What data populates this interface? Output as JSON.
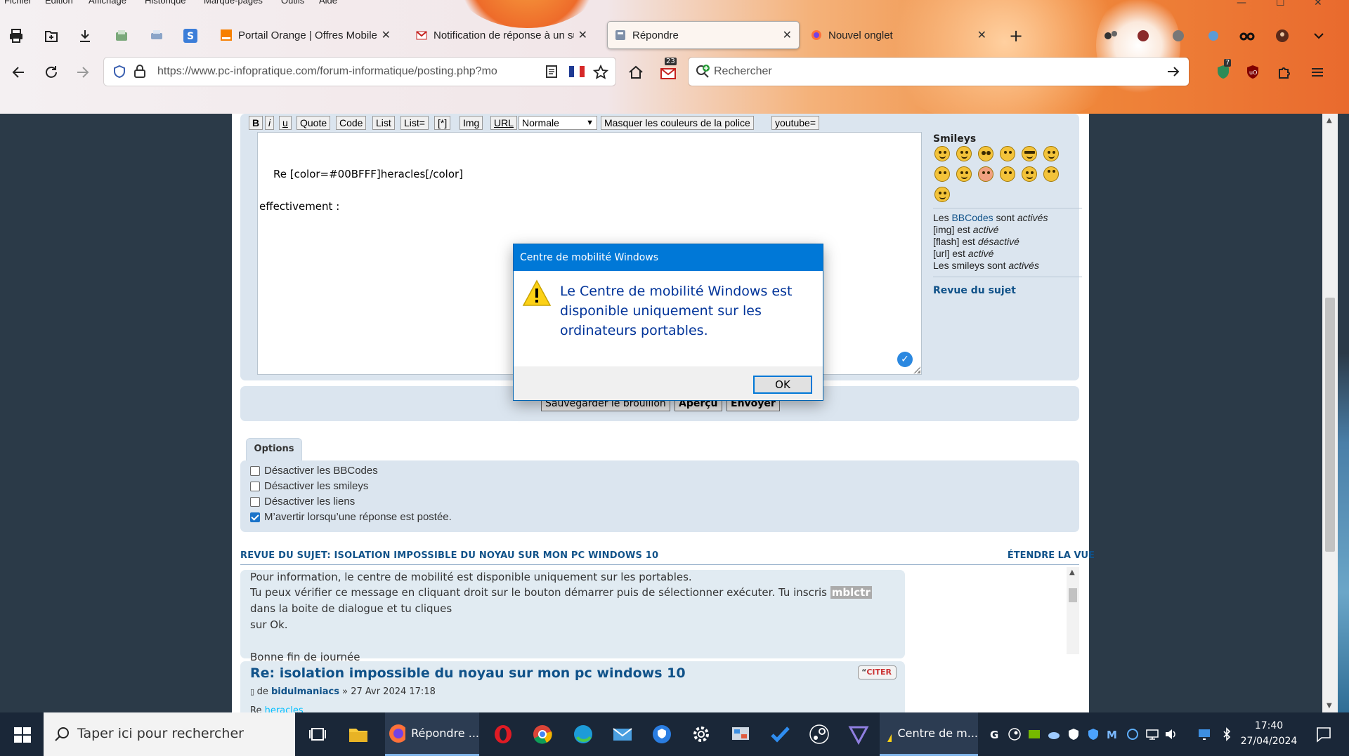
{
  "browser": {
    "menu": [
      "Fichier",
      "Edition",
      "Affichage",
      "Historique",
      "Marque-pages",
      "Outils",
      "Aide"
    ],
    "tabs": [
      {
        "title": "Portail Orange | Offres Mobiles",
        "active": false,
        "favicon": "orange-square-icon"
      },
      {
        "title": "Notification de réponse à un su",
        "active": false,
        "favicon": "gmail-icon"
      },
      {
        "title": "Répondre",
        "active": true,
        "favicon": "forum-icon"
      },
      {
        "title": "Nouvel onglet",
        "active": false,
        "favicon": "firefox-icon"
      }
    ],
    "url": "https://www.pc-infopratique.com/forum-informatique/posting.php?mo",
    "search_placeholder": "Rechercher",
    "mail_badge": "23",
    "shield_badge": "7"
  },
  "toolbar": {
    "buttons": [
      "B",
      "i",
      "u",
      "Quote",
      "Code",
      "List",
      "List=",
      "[*]",
      "Img",
      "URL"
    ],
    "font_size_select": "Normale",
    "hide_colors": "Masquer les couleurs de la police",
    "youtube": "youtube="
  },
  "editor": {
    "line1": "Re [color=#00BFFF]heracles[/color]",
    "line2": "effectivement :"
  },
  "sidebar": {
    "smileys_title": "Smileys",
    "bbcodes_prefix": "Les ",
    "bbcodes_link": "BBCodes",
    "bbcodes_suffix": " sont ",
    "bbcodes_state": "activés",
    "img_label": "[img] est ",
    "img_state": "activé",
    "flash_label": "[flash] est ",
    "flash_state": "désactivé",
    "url_label": "[url] est ",
    "url_state": "activé",
    "smileys_label": "Les smileys sont ",
    "smileys_state": "activés",
    "revue_link": "Revue du sujet"
  },
  "actions": {
    "save_draft": "Sauvegarder le brouillon",
    "preview": "Aperçu",
    "submit": "Envoyer"
  },
  "options": {
    "tab_label": "Options",
    "items": [
      {
        "label": "Désactiver les BBCodes",
        "checked": false
      },
      {
        "label": "Désactiver les smileys",
        "checked": false
      },
      {
        "label": "Désactiver les liens",
        "checked": false
      },
      {
        "label": "M’avertir lorsqu’une réponse est postée.",
        "checked": true
      }
    ]
  },
  "review": {
    "heading": "REVUE DU SUJET: ISOLATION IMPOSSIBLE DU NOYAU SUR MON PC WINDOWS 10",
    "expand": "ÉTENDRE LA VUE",
    "post1_line1": "Pour information, le centre de mobilité est disponible uniquement sur les portables.",
    "post1_line2a": "Tu peux vérifier ce message en cliquant droit sur le bouton démarrer puis de sélectionner exécuter. Tu inscris ",
    "post1_highlight": "mblctr",
    "post1_line2b": " dans la boite de dialogue et tu cliques",
    "post1_line3": "sur Ok.",
    "post1_line4": "Bonne fin de journée",
    "post2_title": "Re: isolation impossible du noyau sur mon pc windows 10",
    "post2_by": "de ",
    "post2_author": "bidulmaniacs",
    "post2_date": " » 27 Avr 2024 17:18",
    "post2_quote_btn": "CITER",
    "post2_snippet_prefix": "Re ",
    "post2_snippet_name": "heracles"
  },
  "dialog": {
    "title": "Centre de mobilité Windows",
    "message": "Le Centre de mobilité Windows est disponible uniquement sur les ordinateurs portables.",
    "ok": "OK"
  },
  "taskbar": {
    "search_placeholder": "Taper ici pour rechercher",
    "firefox_label": "Répondre ...",
    "mobility_label": "Centre de m...",
    "time": "17:40",
    "date": "27/04/2024"
  },
  "colors": {
    "link": "#105289",
    "panel": "#dbe5ef",
    "dialog_title": "#0078d7",
    "dialog_text": "#003399",
    "taskbar": "#1a2738"
  }
}
